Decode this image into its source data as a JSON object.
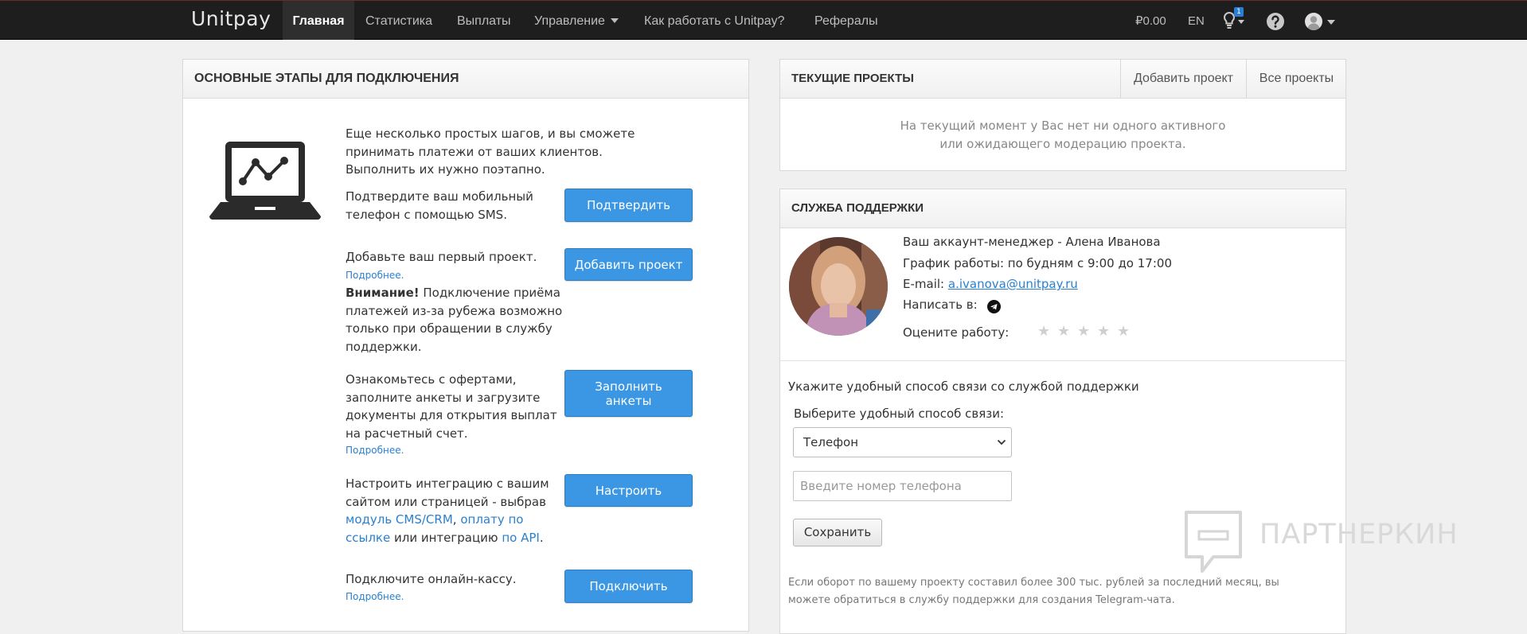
{
  "nav": {
    "logo": "Unitpay",
    "items": [
      {
        "label": "Главная"
      },
      {
        "label": "Статистика"
      },
      {
        "label": "Выплаты"
      },
      {
        "label": "Управление"
      },
      {
        "label": "Как работать с Unitpay?"
      },
      {
        "label": "Рефералы"
      }
    ],
    "balance": "₽0.00",
    "lang": "EN",
    "notifications_count": "1"
  },
  "steps_panel": {
    "title": "ОСНОВНЫЕ ЭТАПЫ ДЛЯ ПОДКЛЮЧЕНИЯ",
    "intro": "Еще несколько простых шагов, и вы сможете принимать платежи от ваших клиентов. Выполнить их нужно поэтапно.",
    "step1_text": "Подтвердите ваш мобильный телефон с помощью SMS.",
    "step1_button": "Подтвердить",
    "step2_text": "Добавьте ваш первый проект.",
    "step2_more": "Подробнее.",
    "step2_warning_label": "Внимание!",
    "step2_warning_text": "Подключение приёма платежей из-за рубежа возможно только при обращении в службу поддержки.",
    "step2_button": "Добавить проект",
    "step3_text": "Ознакомьтесь с офертами, заполните анкеты и загрузите документы для открытия выплат на расчетный счет.",
    "step3_more": "Подробнее.",
    "step3_button": "Заполнить анкеты",
    "step4_text_a": "Настроить интеграцию с вашим сайтом или страницей - выбрав",
    "step4_link1": "модуль CMS/CRM",
    "step4_sep": ",",
    "step4_link2": "оплату по ссылке",
    "step4_text_b": "или интеграцию",
    "step4_link3": "по API",
    "step4_end": ".",
    "step4_button": "Настроить",
    "step5_text": "Подключите онлайн-кассу.",
    "step5_more": "Подробнее.",
    "step5_button": "Подключить"
  },
  "projects_panel": {
    "title": "ТЕКУЩИЕ ПРОЕКТЫ",
    "add_button": "Добавить проект",
    "all_button": "Все проекты",
    "empty_line1": "На текущий момент у Вас нет ни одного активного",
    "empty_line2": "или ожидающего модерацию проекта."
  },
  "support_panel": {
    "title": "СЛУЖБА ПОДДЕРЖКИ",
    "manager": "Ваш аккаунт-менеджер - Алена Иванова",
    "schedule": "График работы: по будням с 9:00 до 17:00",
    "email_label": "E-mail:",
    "email": "a.ivanova@unitpay.ru",
    "write_label": "Написать в:",
    "rate_label": "Оцените работу:",
    "rating": 0,
    "contact_heading": "Укажите удобный способ связи со службой поддержки",
    "contact_select_label": "Выберите удобный способ связи:",
    "contact_selected": "Телефон",
    "phone_placeholder": "Введите номер телефона",
    "save_button": "Сохранить",
    "footnote": "Если оборот по вашему проекту составил более 300 тыс. рублей за последний месяц, вы можете обратиться в службу поддержки для создания Telegram-чата."
  },
  "watermark": {
    "text": "ПАРТНЕРКИН"
  }
}
